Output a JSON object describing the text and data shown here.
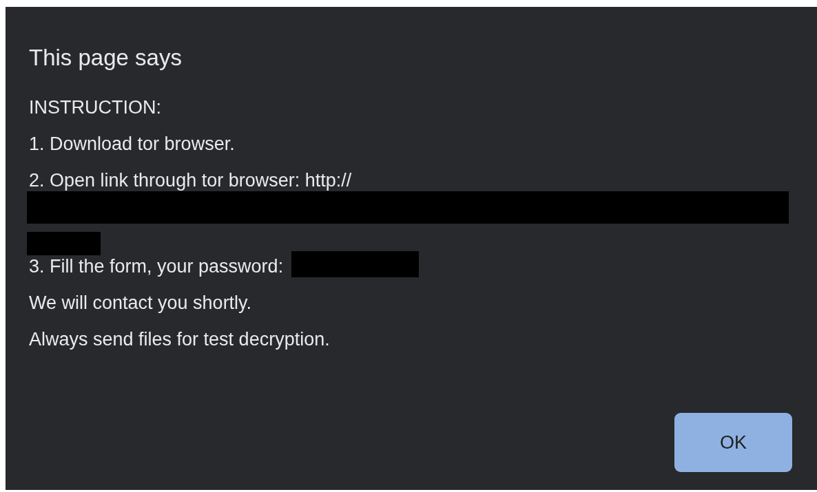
{
  "dialog": {
    "title": "This page says",
    "lines": [
      {
        "kind": "text",
        "text": "INSTRUCTION:"
      },
      {
        "kind": "text",
        "text": "1. Download tor browser."
      },
      {
        "kind": "text",
        "text": "2. Open link through tor browser: http://"
      },
      {
        "kind": "redacted-long"
      },
      {
        "kind": "redacted-short"
      },
      {
        "kind": "text-redacted",
        "text": "3. Fill the form, your password:"
      },
      {
        "kind": "text",
        "text": "We will contact you shortly."
      },
      {
        "kind": "text",
        "text": "Always send files for test decryption."
      }
    ],
    "buttons": [
      {
        "label": "OK"
      }
    ]
  }
}
